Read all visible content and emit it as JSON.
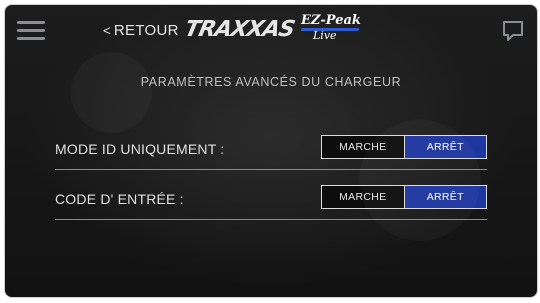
{
  "header": {
    "back_label": "RETOUR",
    "back_chevron": "<",
    "brand": "TRAXXAS",
    "product_line1": "EZ-Peak",
    "product_line2": "Live",
    "menu_icon": "hamburger-menu-icon",
    "chat_icon": "chat-bubble-icon"
  },
  "page": {
    "title": "PARAMÈTRES AVANCÉS DU CHARGEUR"
  },
  "settings": [
    {
      "label": "MODE ID UNIQUEMENT :",
      "on_label": "MARCHE",
      "off_label": "ARRÊT",
      "selected": "ARRÊT"
    },
    {
      "label": "CODE D' ENTRÉE :",
      "on_label": "MARCHE",
      "off_label": "ARRÊT",
      "selected": "ARRÊT"
    }
  ],
  "colors": {
    "background": "#161616",
    "selected_option": "#1e36a0",
    "unselected_option": "#0d0d0d",
    "text": "#e0e0e0",
    "logo_accent": "#2b5cd6"
  }
}
